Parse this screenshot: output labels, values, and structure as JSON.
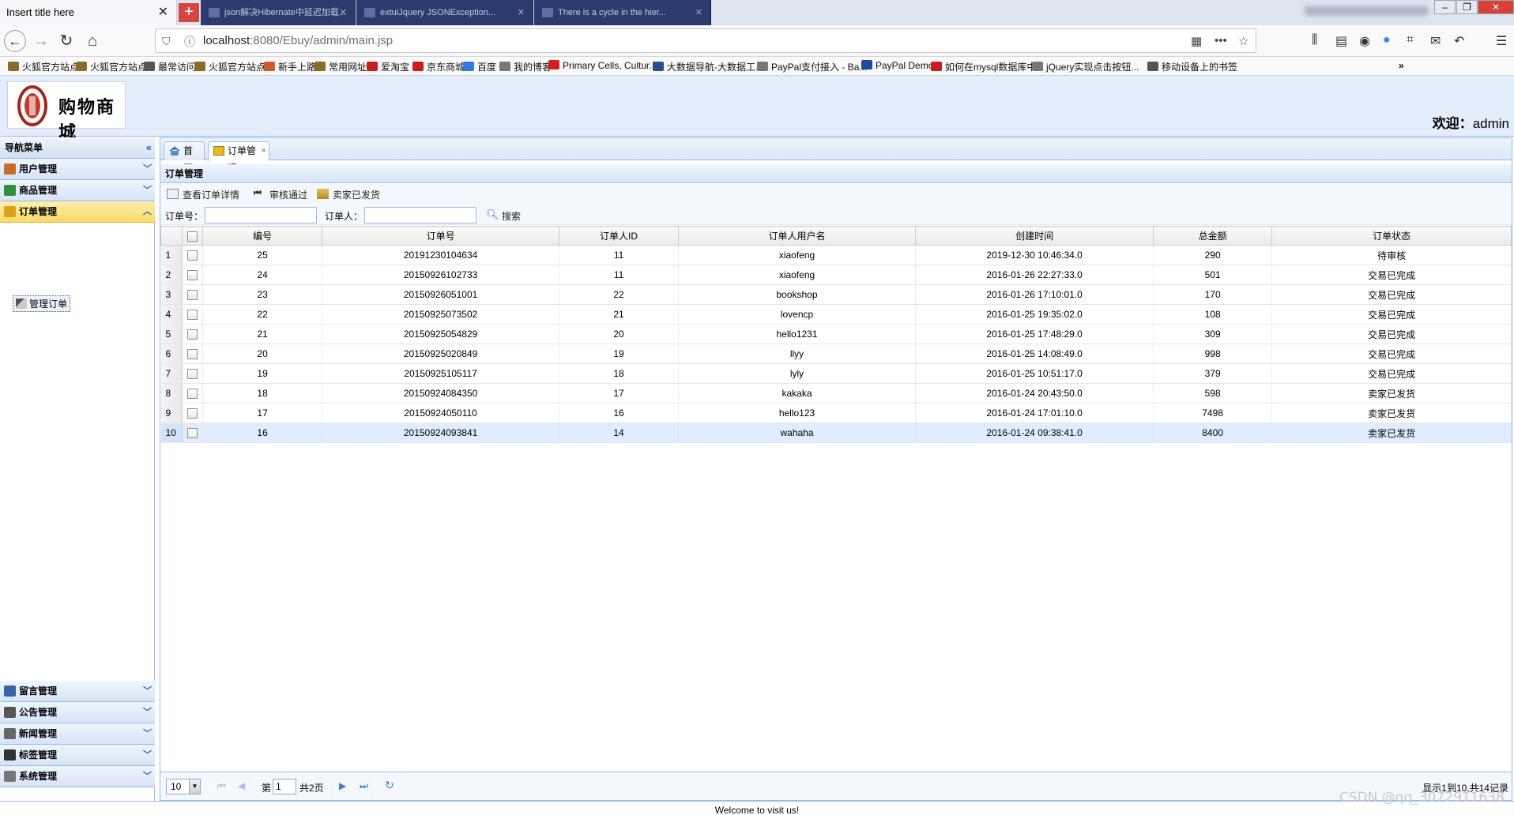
{
  "browser": {
    "active_tab_title": "Insert title here",
    "background_tabs": [
      "json解决Hibernate中延迟加载...",
      "extuiJquery JSONException...",
      "There is a cycle in the hier..."
    ],
    "url_host": "localhost",
    "url_rest": ":8080/Ebuy/admin/main.jsp",
    "bookmarks": [
      "火狐官方站点",
      "火狐官方站点",
      "最常访问",
      "火狐官方站点",
      "新手上路",
      "常用网址",
      "爱淘宝",
      "京东商城",
      "百度",
      "我的博客",
      "Primary Cells, Cultur...",
      "大数据导航-大数据工...",
      "PayPal支付接入 - Ba...",
      "PayPal Demo",
      "如何在mysql数据库中...",
      "jQuery实现点击按钮...",
      "移动设备上的书签"
    ]
  },
  "header": {
    "logo_text": "购物商城",
    "welcome_label": "欢迎：",
    "username": "admin"
  },
  "nav": {
    "title": "导航菜单",
    "panels": [
      {
        "label": "用户管理",
        "color": "#c86b2b"
      },
      {
        "label": "商品管理",
        "color": "#2f8f3d"
      },
      {
        "label": "订单管理",
        "color": "#d8a21c"
      },
      {
        "label": "留言管理",
        "color": "#3a64a8"
      },
      {
        "label": "公告管理",
        "color": "#555555"
      },
      {
        "label": "新闻管理",
        "color": "#666666"
      },
      {
        "label": "标签管理",
        "color": "#333333"
      },
      {
        "label": "系统管理",
        "color": "#777777"
      }
    ],
    "active_sub_item": "管理订单"
  },
  "tabs": [
    {
      "label": "首页"
    },
    {
      "label": "订单管理"
    }
  ],
  "content": {
    "title": "订单管理",
    "toolbar": {
      "view_detail": "查看订单详情",
      "approve": "审核通过",
      "shipped": "卖家已发货"
    },
    "search": {
      "order_no_label": "订单号：",
      "orderer_label": "订单人：",
      "search_button": "搜索"
    },
    "columns": [
      "编号",
      "订单号",
      "订单人ID",
      "订单人用户名",
      "创建时间",
      "总金额",
      "订单状态"
    ],
    "rows": [
      {
        "n": "1",
        "id": "25",
        "order_no": "20191230104634",
        "user_id": "11",
        "username": "xiaofeng",
        "created": "2019-12-30 10:46:34.0",
        "total": "290",
        "status": "待审核"
      },
      {
        "n": "2",
        "id": "24",
        "order_no": "20150926102733",
        "user_id": "11",
        "username": "xiaofeng",
        "created": "2016-01-26 22:27:33.0",
        "total": "501",
        "status": "交易已完成"
      },
      {
        "n": "3",
        "id": "23",
        "order_no": "20150926051001",
        "user_id": "22",
        "username": "bookshop",
        "created": "2016-01-26 17:10:01.0",
        "total": "170",
        "status": "交易已完成"
      },
      {
        "n": "4",
        "id": "22",
        "order_no": "20150925073502",
        "user_id": "21",
        "username": "lovencp",
        "created": "2016-01-25 19:35:02.0",
        "total": "108",
        "status": "交易已完成"
      },
      {
        "n": "5",
        "id": "21",
        "order_no": "20150925054829",
        "user_id": "20",
        "username": "hello1231",
        "created": "2016-01-25 17:48:29.0",
        "total": "309",
        "status": "交易已完成"
      },
      {
        "n": "6",
        "id": "20",
        "order_no": "20150925020849",
        "user_id": "19",
        "username": "llyy",
        "created": "2016-01-25 14:08:49.0",
        "total": "998",
        "status": "交易已完成"
      },
      {
        "n": "7",
        "id": "19",
        "order_no": "20150925105117",
        "user_id": "18",
        "username": "lyly",
        "created": "2016-01-25 10:51:17.0",
        "total": "379",
        "status": "交易已完成"
      },
      {
        "n": "8",
        "id": "18",
        "order_no": "20150924084350",
        "user_id": "17",
        "username": "kakaka",
        "created": "2016-01-24 20:43:50.0",
        "total": "598",
        "status": "卖家已发货"
      },
      {
        "n": "9",
        "id": "17",
        "order_no": "20150924050110",
        "user_id": "16",
        "username": "hello123",
        "created": "2016-01-24 17:01:10.0",
        "total": "7498",
        "status": "卖家已发货"
      },
      {
        "n": "10",
        "id": "16",
        "order_no": "20150924093841",
        "user_id": "14",
        "username": "wahaha",
        "created": "2016-01-24 09:38:41.0",
        "total": "8400",
        "status": "卖家已发货"
      }
    ]
  },
  "pager": {
    "page_size": "10",
    "page_prefix": "第",
    "page_value": "1",
    "page_suffix": "共2页",
    "info": "显示1到10,共14记录"
  },
  "footer": {
    "text": "Welcome to visit us!"
  },
  "watermark": "CSDN @qq_3072911638"
}
